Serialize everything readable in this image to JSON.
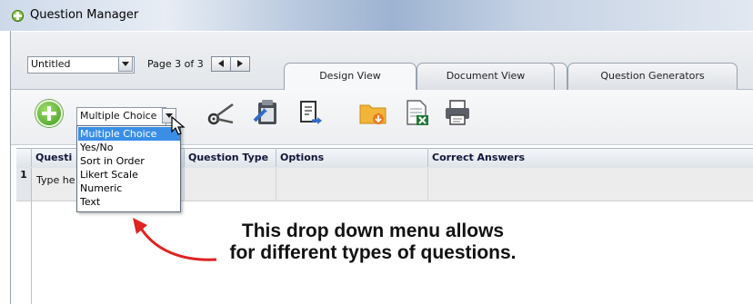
{
  "window": {
    "title": "Question Manager"
  },
  "top": {
    "file_name": "Untitled",
    "page_indicator": "Page 3 of 3"
  },
  "tabs": [
    {
      "label": "Design View",
      "active": true
    },
    {
      "label": "Document View",
      "active": false
    },
    {
      "label": "Question Generators",
      "active": false
    }
  ],
  "toolbar": {
    "question_type_value": "Multiple Choice",
    "icons": [
      "add-question-icon",
      "cut-icon",
      "paste-icon",
      "export-icon",
      "import-folder-icon",
      "excel-export-icon",
      "print-icon"
    ]
  },
  "dropdown": {
    "options": [
      "Multiple Choice",
      "Yes/No",
      "Sort in Order",
      "Likert Scale",
      "Numeric",
      "Text"
    ],
    "selected": "Multiple Choice"
  },
  "grid": {
    "columns": [
      "Questi",
      "Question Type",
      "Options",
      "Correct Answers"
    ],
    "rows": [
      {
        "num": "1",
        "question": "Type he"
      }
    ]
  },
  "annotation": {
    "line1": "This drop down menu allows",
    "line2": "for different types of questions."
  },
  "colors": {
    "accent_red": "#e02222",
    "selection_blue": "#3a8ee6",
    "add_green": "#3f9a1d"
  }
}
